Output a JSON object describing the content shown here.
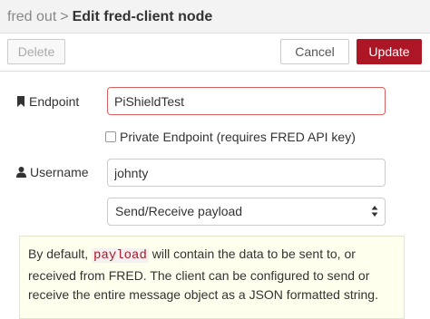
{
  "header": {
    "parent": "fred out",
    "separator": ">",
    "title": "Edit fred-client node"
  },
  "toolbar": {
    "delete_label": "Delete",
    "cancel_label": "Cancel",
    "update_label": "Update"
  },
  "form": {
    "endpoint": {
      "label": "Endpoint",
      "icon": "bookmark-icon",
      "value": "PiShieldTest"
    },
    "private_endpoint": {
      "label": "Private Endpoint (requires FRED API key)",
      "checked": false
    },
    "username": {
      "label": "Username",
      "icon": "user-icon",
      "value": "johnty"
    },
    "mode": {
      "selected": "Send/Receive payload"
    }
  },
  "tip": {
    "before": "By default, ",
    "code": "payload",
    "after": " will contain the data to be sent to, or received from FRED. The client can be configured to send or receive the entire message object as a JSON formatted string."
  },
  "colors": {
    "accent": "#ad1625",
    "error_border": "#d6615f",
    "tip_background": "#ffffee"
  }
}
